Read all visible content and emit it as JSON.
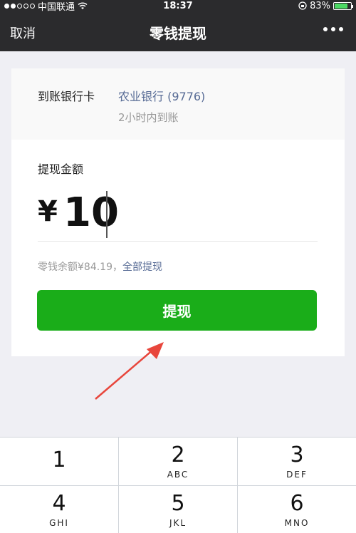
{
  "status_bar": {
    "carrier": "中国联通",
    "time": "18:37",
    "battery": "83%",
    "battery_level": 0.83,
    "wifi_icon": "wifi-icon",
    "rotation_lock_icon": "rotation-lock-icon"
  },
  "nav": {
    "cancel_label": "取消",
    "title": "零钱提现",
    "more_icon": "more-dots-icon"
  },
  "bank": {
    "label": "到账银行卡",
    "name": "农业银行 (9776)",
    "arrival_time": "2小时内到账"
  },
  "amount": {
    "label": "提现金额",
    "currency": "¥",
    "value": "10"
  },
  "balance": {
    "text": "零钱余额¥84.19，",
    "withdraw_all": "全部提现"
  },
  "submit_label": "提现",
  "keypad": [
    {
      "num": "1",
      "letters": ""
    },
    {
      "num": "2",
      "letters": "ABC"
    },
    {
      "num": "3",
      "letters": "DEF"
    },
    {
      "num": "4",
      "letters": "GHI"
    },
    {
      "num": "5",
      "letters": "JKL"
    },
    {
      "num": "6",
      "letters": "MNO"
    }
  ],
  "colors": {
    "accent_green": "#1aad19",
    "link_blue": "#576b95",
    "nav_bg": "#2b2b2d",
    "arrow_red": "#e8463c"
  }
}
